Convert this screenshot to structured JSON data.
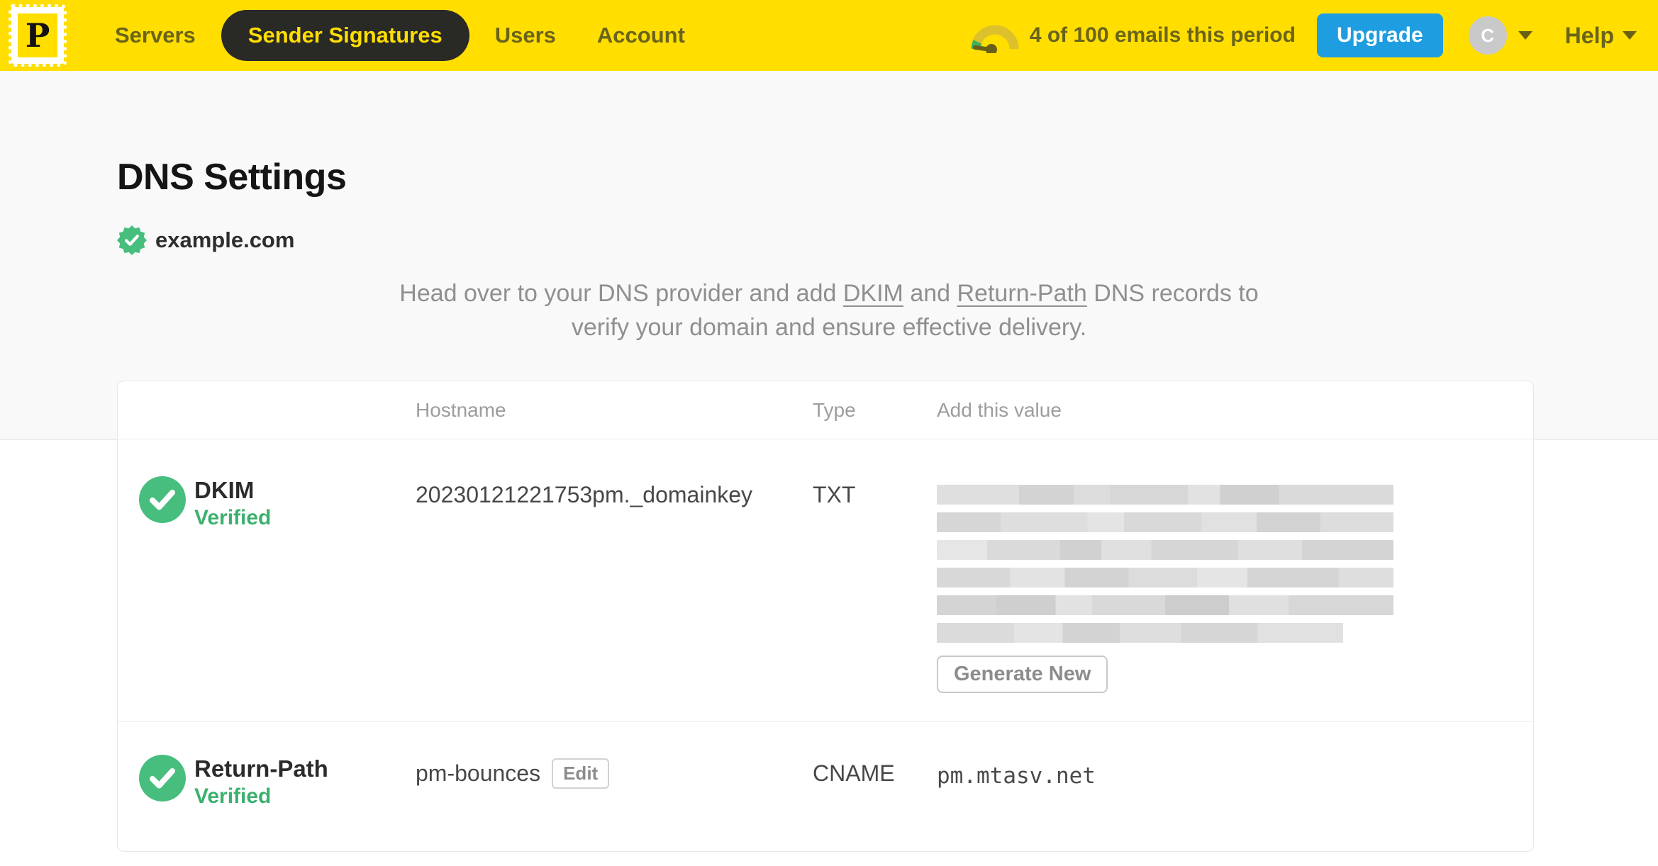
{
  "nav": {
    "logo_letter": "P",
    "items": [
      {
        "label": "Servers",
        "active": false
      },
      {
        "label": "Sender Signatures",
        "active": true
      },
      {
        "label": "Users",
        "active": false
      },
      {
        "label": "Account",
        "active": false
      }
    ],
    "usage_text": "4 of 100 emails this period",
    "upgrade_label": "Upgrade",
    "avatar_initial": "C",
    "help_label": "Help"
  },
  "page": {
    "title": "DNS Settings",
    "domain": "example.com",
    "intro": {
      "p1": "Head over to your DNS provider and add ",
      "link1": "DKIM",
      "p2": " and ",
      "link2": "Return-Path",
      "p3": " DNS records to",
      "p4": "verify your domain and ensure effective delivery."
    }
  },
  "table": {
    "headers": {
      "hostname": "Hostname",
      "type": "Type",
      "value": "Add this value"
    },
    "rows": [
      {
        "name": "DKIM",
        "status": "Verified",
        "hostname": "20230121221753pm._domainkey",
        "type": "TXT",
        "value_redacted": true,
        "redacted_lines": 6,
        "action_label": "Generate New"
      },
      {
        "name": "Return-Path",
        "status": "Verified",
        "hostname": "pm-bounces",
        "edit_label": "Edit",
        "type": "CNAME",
        "value": "pm.mtasv.net"
      }
    ]
  },
  "colors": {
    "brand_yellow": "#FFDE00",
    "nav_text": "#6A631B",
    "active_pill_bg": "#292925",
    "upgrade_blue": "#1E9DE0",
    "success_green": "#47BE7D",
    "verified_text_green": "#3BB06E"
  }
}
